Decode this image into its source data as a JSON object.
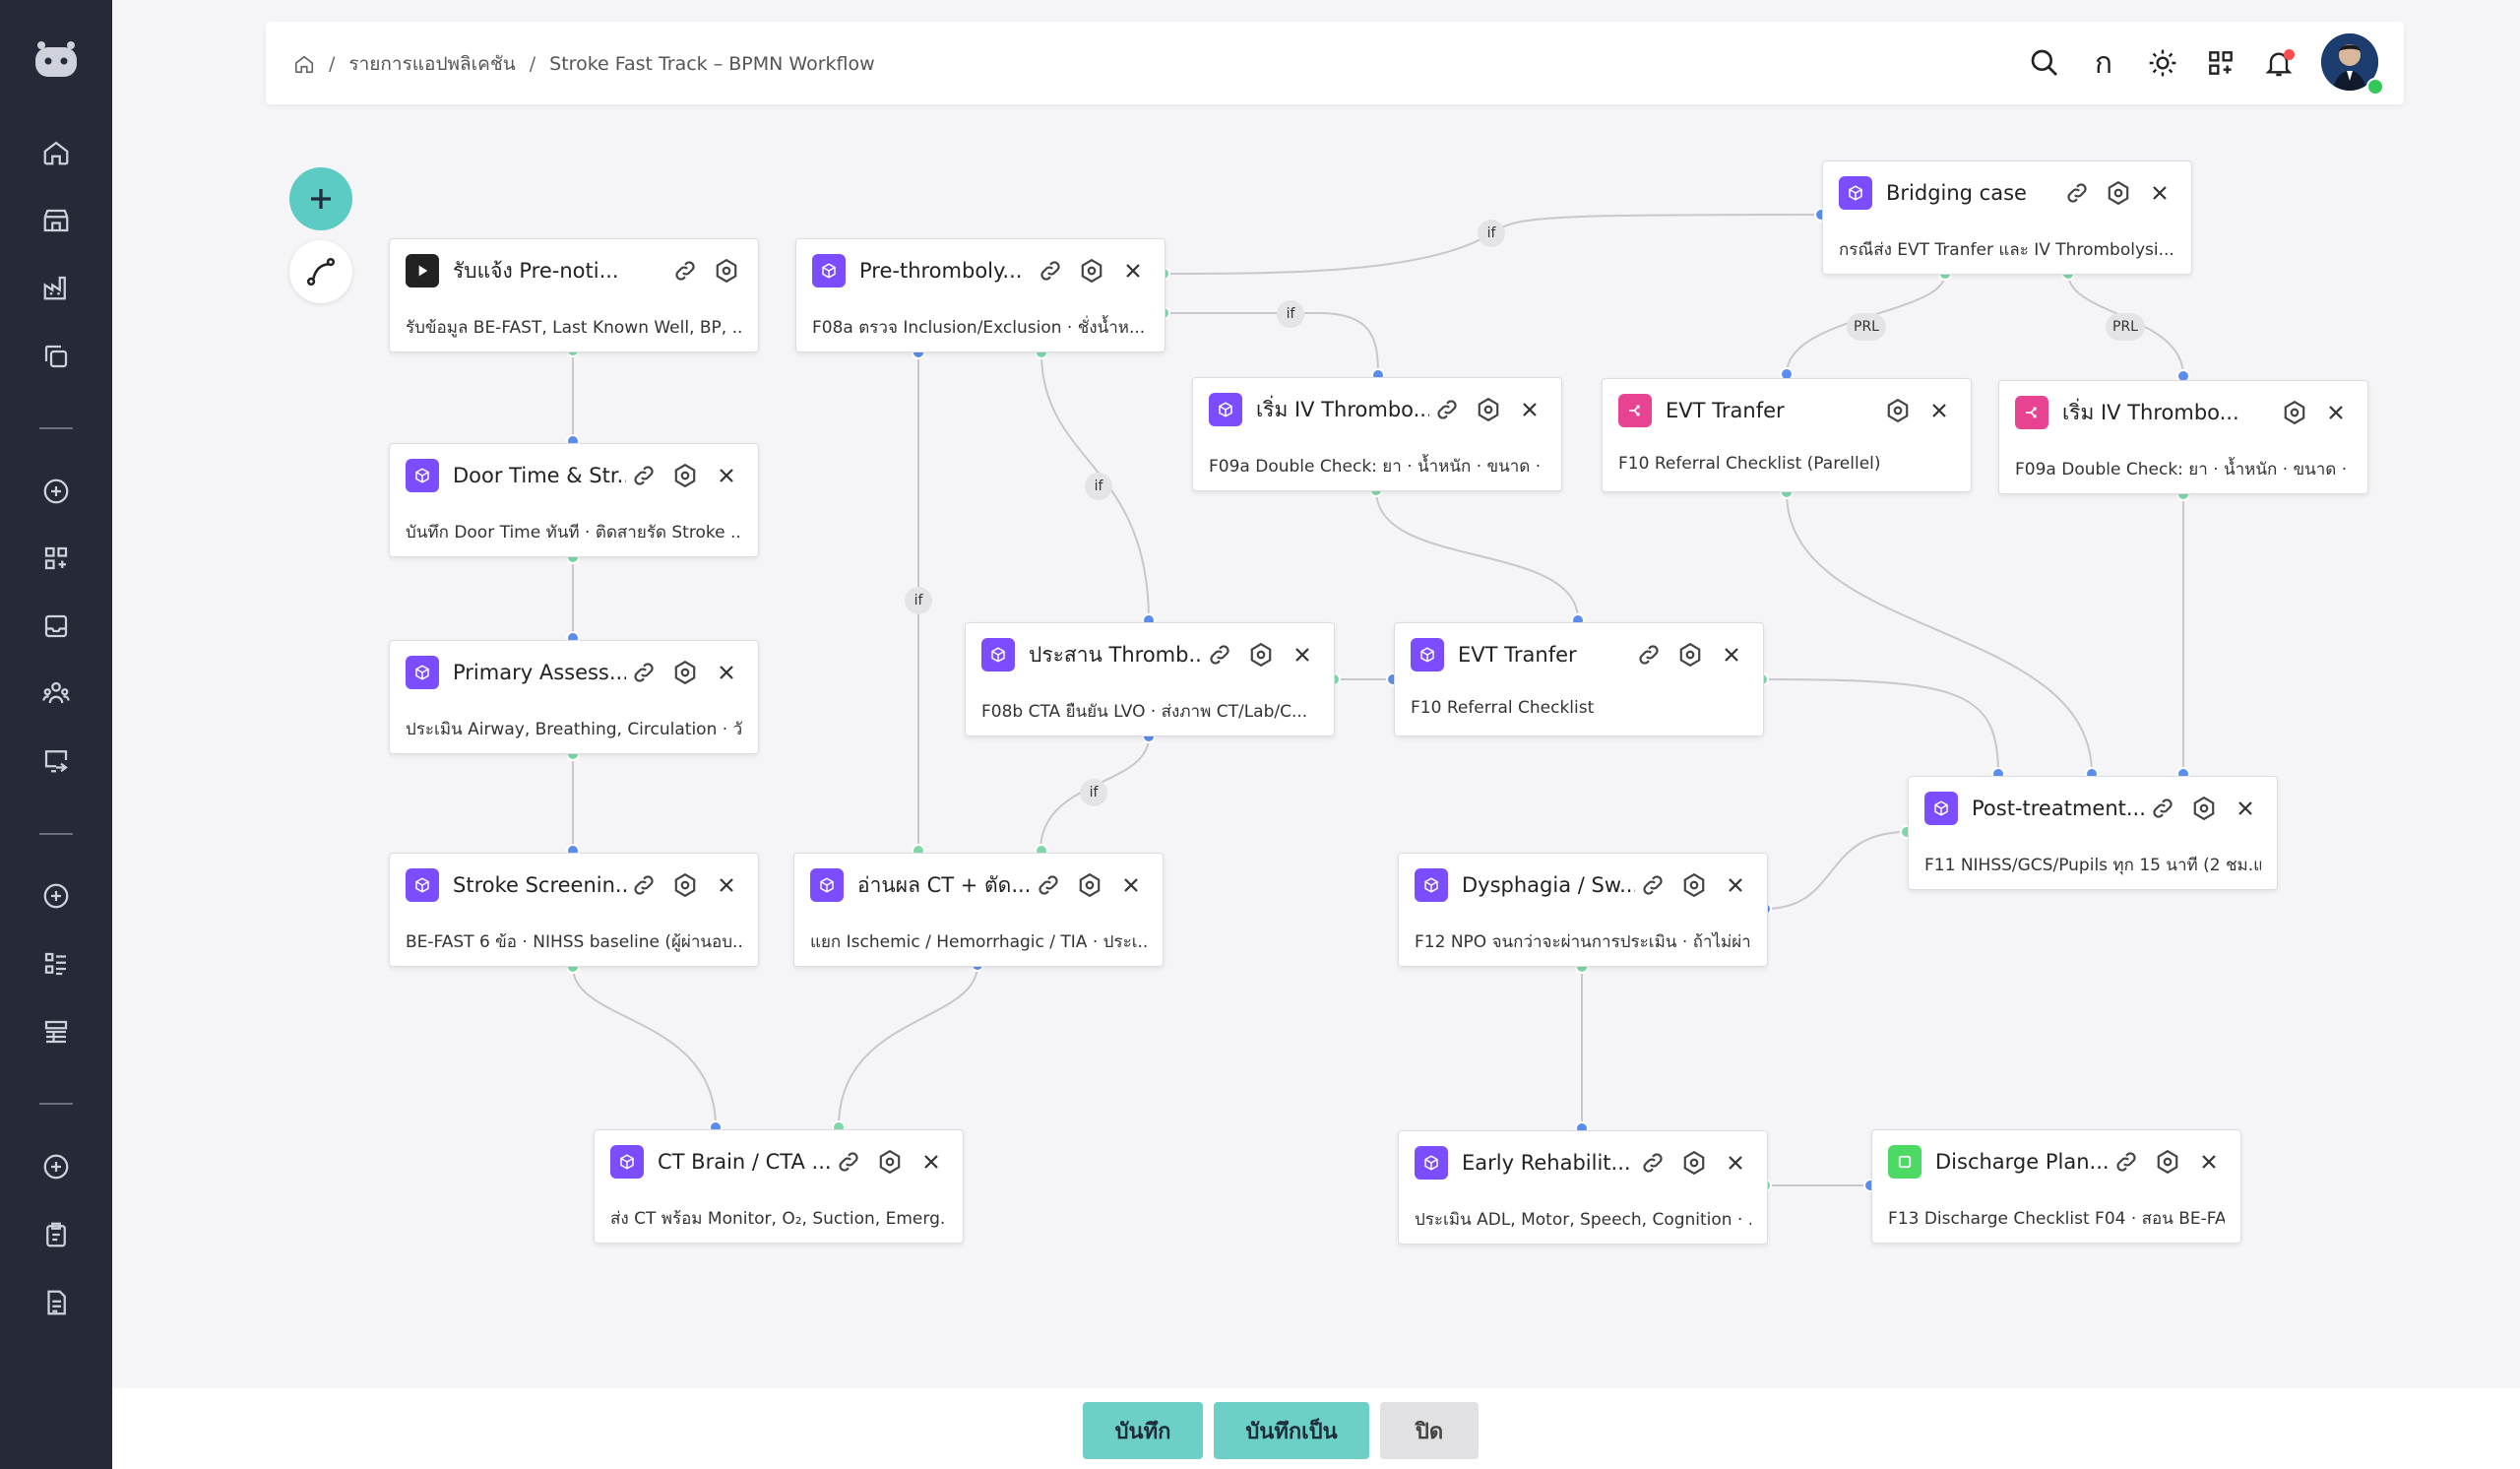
{
  "breadcrumb": {
    "home_icon": "home-icon",
    "item1": "รายการแอปพลิเคชัน",
    "item2": "Stroke Fast Track – BPMN Workflow",
    "sep": "/"
  },
  "header": {
    "lang_label": "ก",
    "icons": [
      "search-icon",
      "language-icon",
      "sun-icon",
      "apps-icon",
      "bell-icon"
    ]
  },
  "sidebar": {
    "icons": [
      "robot-logo-icon",
      "home-icon",
      "store-icon",
      "factory-icon",
      "copy-icon",
      "plus-circle-icon",
      "grid-icon",
      "inbox-icon",
      "users-icon",
      "screen-arrow-icon",
      "plus-circle-icon",
      "list-icon",
      "table-icon",
      "plus-circle-icon",
      "clipboard-icon",
      "document-icon"
    ]
  },
  "colors": {
    "accent": "#5ccbc3",
    "node_purple": "#7c4dff",
    "node_pink": "#e84393",
    "node_green": "#4cd964",
    "start_dark": "#222222",
    "edge": "#c8c8cc",
    "handle_blue": "#5b8def",
    "handle_green": "#7ed9a7"
  },
  "nodes": {
    "n1": {
      "title": "รับแจ้ง Pre-noti...",
      "subtitle": "รับข้อมูล BE-FAST, Last Known Well, BP, ..."
    },
    "n2": {
      "title": "Door Time & Str...",
      "subtitle": "บันทึก Door Time ทันที · ติดสายรัด Stroke ..."
    },
    "n3": {
      "title": "Primary Assess...",
      "subtitle": "ประเมิน Airway, Breathing, Circulation · วั..."
    },
    "n4": {
      "title": "Stroke Screenin...",
      "subtitle": "BE-FAST 6 ข้อ · NIHSS baseline (ผู้ผ่านอบ..."
    },
    "n5": {
      "title": "CT Brain / CTA ...",
      "subtitle": "ส่ง CT พร้อม Monitor, O₂, Suction, Emerg..."
    },
    "n6": {
      "title": "Pre-thromboly...",
      "subtitle": "F08a ตรวจ Inclusion/Exclusion · ชั่งน้ำห..."
    },
    "n7": {
      "title": "อ่านผล CT + ตัด...",
      "subtitle": "แยก Ischemic / Hemorrhagic / TIA · ประเ..."
    },
    "n8": {
      "title": "เริ่ม IV Thrombo...",
      "subtitle": "F09a Double Check: ยา · น้ำหนัก · ขนาด · ..."
    },
    "n9": {
      "title": "ประสาน Thromb...",
      "subtitle": "F08b CTA ยืนยัน LVO · ส่งภาพ CT/Lab/C..."
    },
    "n10": {
      "title": "EVT Tranfer",
      "subtitle": "F10 Referral Checklist"
    },
    "n11": {
      "title": "Bridging case",
      "subtitle": "กรณีส่ง EVT Tranfer และ IV Thrombolysi..."
    },
    "n12": {
      "title": "EVT Tranfer",
      "subtitle": "F10 Referral Checklist (Parellel)"
    },
    "n13": {
      "title": "เริ่ม IV Thrombo...",
      "subtitle": "F09a Double Check: ยา · น้ำหนัก · ขนาด · ..."
    },
    "n14": {
      "title": "Post-treatment...",
      "subtitle": "F11 NIHSS/GCS/Pupils ทุก 15 นาที (2 ชม.แร..."
    },
    "n15": {
      "title": "Dysphagia / Sw...",
      "subtitle": "F12 NPO จนกว่าจะผ่านการประเมิน · ถ้าไม่ผ่า..."
    },
    "n16": {
      "title": "Early Rehabilit...",
      "subtitle": "ประเมิน ADL, Motor, Speech, Cognition · ..."
    },
    "n17": {
      "title": "Discharge Plan...",
      "subtitle": "F13 Discharge Checklist F04 · สอน BE-FA..."
    }
  },
  "edge_labels": {
    "if": "if",
    "prl": "PRL"
  },
  "footer": {
    "save": "บันทึก",
    "save_as": "บันทึกเป็น",
    "close": "ปิด"
  }
}
